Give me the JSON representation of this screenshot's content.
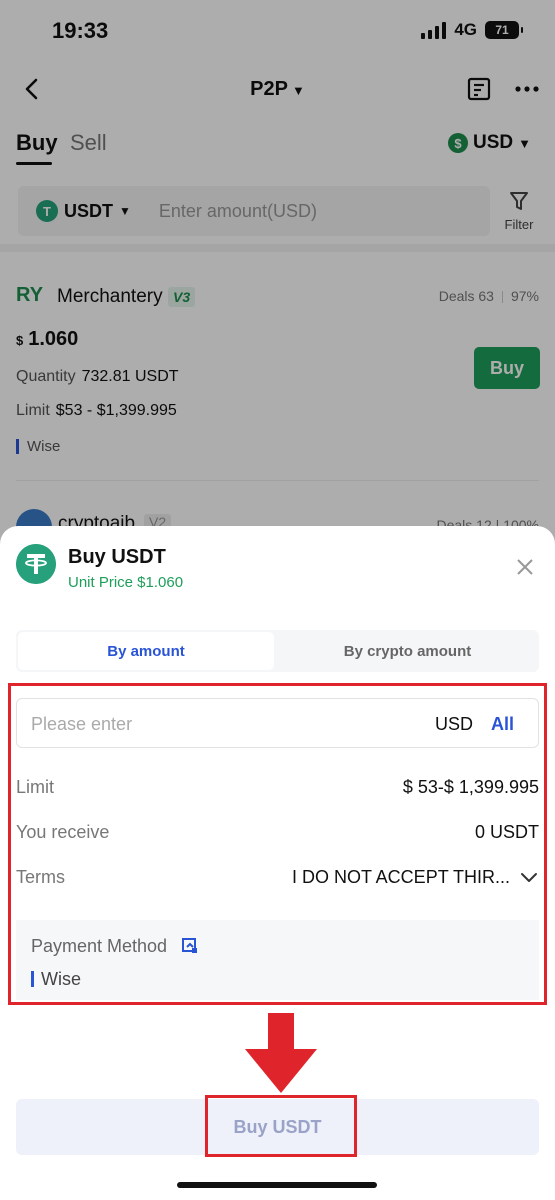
{
  "status_bar": {
    "time": "19:33",
    "network": "4G",
    "battery": "71"
  },
  "nav": {
    "title": "P2P"
  },
  "tabs": {
    "buy": "Buy",
    "sell": "Sell"
  },
  "currency": {
    "symbol": "$",
    "code": "USD"
  },
  "search": {
    "coin": "USDT",
    "coin_icon_letter": "T",
    "placeholder": "Enter amount(USD)",
    "filter_label": "Filter"
  },
  "merchant": {
    "avatar": "RY",
    "name": "Merchantery",
    "level": "V3",
    "deals": "Deals 63",
    "completion": "97%",
    "price_currency": "$",
    "price": "1.060",
    "quantity_label": "Quantity",
    "quantity": "732.81 USDT",
    "limit_label": "Limit",
    "limit": "$53 - $1,399.995",
    "method": "Wise",
    "buy_label": "Buy"
  },
  "next_merchant": {
    "name": "cryptoaib",
    "level": "V2",
    "deals": "Deals 12",
    "completion": "100%"
  },
  "sheet": {
    "title": "Buy USDT",
    "unit_price": "Unit Price $1.060",
    "tab_amount": "By amount",
    "tab_crypto": "By crypto amount",
    "input_placeholder": "Please enter",
    "input_currency": "USD",
    "all_label": "All",
    "limit_label": "Limit",
    "limit_value": "$ 53-$ 1,399.995",
    "receive_label": "You receive",
    "receive_value": "0 USDT",
    "terms_label": "Terms",
    "terms_value": "I DO NOT ACCEPT THIR...",
    "payment_label": "Payment Method",
    "payment_value": "Wise",
    "buy_button": "Buy USDT"
  },
  "colors": {
    "accent_green": "#1e9e5a",
    "tether_green": "#26a17b",
    "link_blue": "#2a54d6",
    "highlight_red": "#e0242c",
    "disabled_button": "#eef0fa"
  }
}
